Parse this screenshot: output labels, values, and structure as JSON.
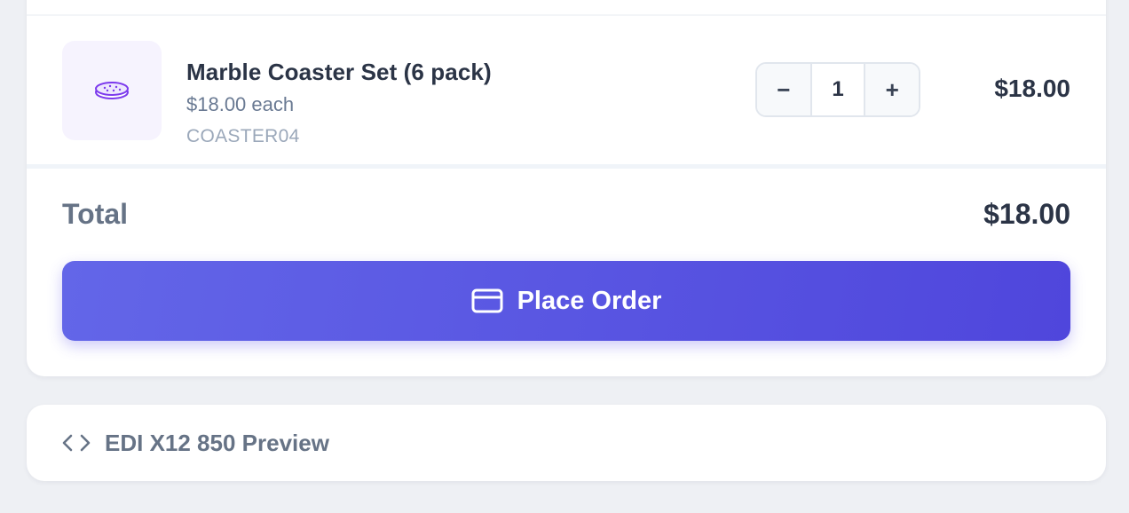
{
  "cart": {
    "items": [
      {
        "name": "Marble Coaster Set (6 pack)",
        "unit_price": "$18.00 each",
        "sku": "COASTER04",
        "quantity": "1",
        "line_total": "$18.00",
        "icon": "coaster-icon"
      }
    ],
    "decrement_symbol": "−",
    "increment_symbol": "+"
  },
  "summary": {
    "total_label": "Total",
    "total_value": "$18.00"
  },
  "actions": {
    "place_order_label": "Place Order",
    "place_order_icon": "credit-card-icon"
  },
  "edi_preview": {
    "label": "EDI X12 850 Preview",
    "icon": "code-icon"
  },
  "colors": {
    "accent": "#4f46e5",
    "background": "#eef0f4"
  }
}
